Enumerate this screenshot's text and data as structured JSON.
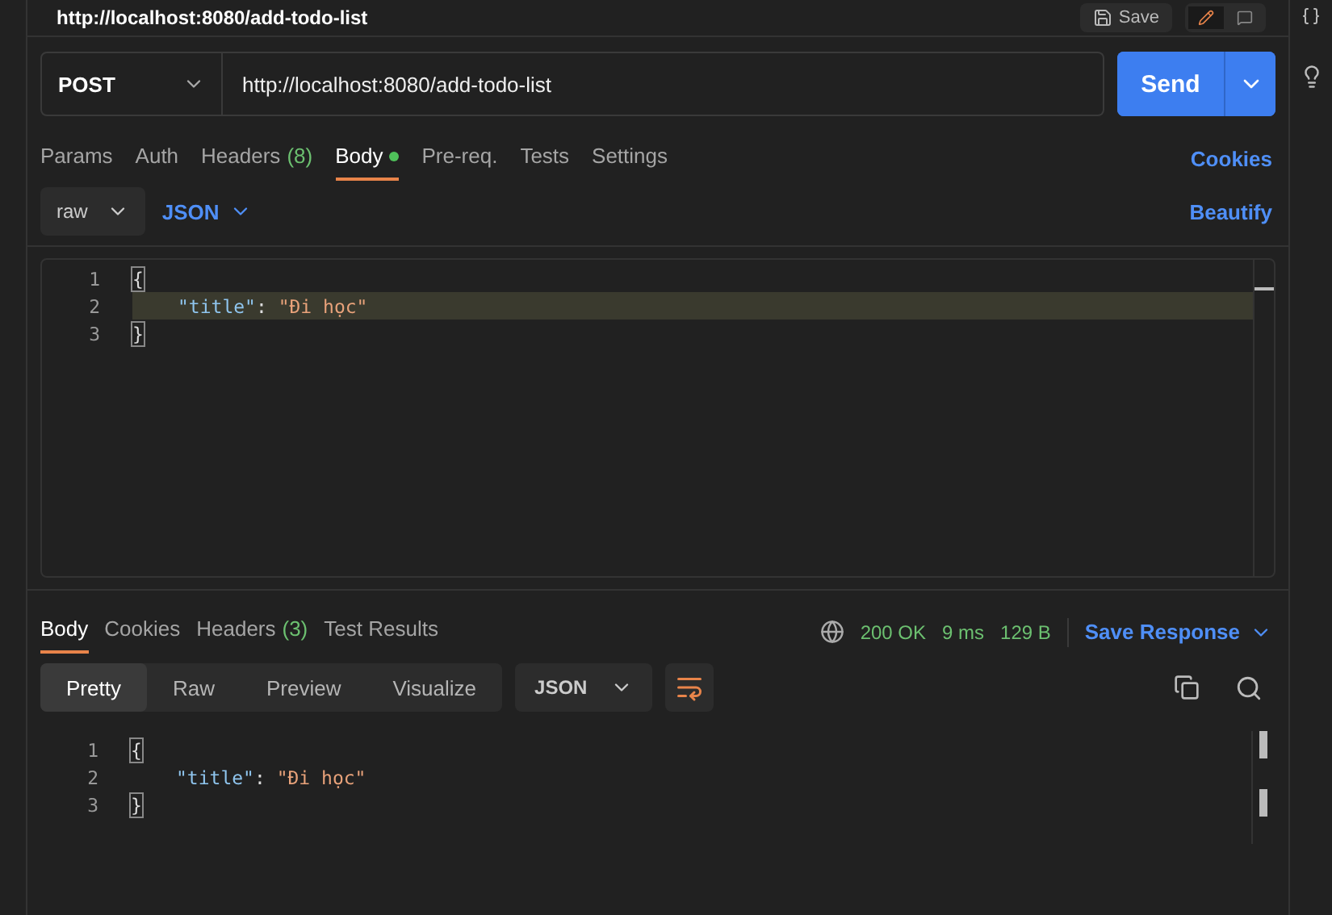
{
  "header": {
    "title": "http://localhost:8080/add-todo-list",
    "save_label": "Save"
  },
  "request": {
    "method": "POST",
    "url": "http://localhost:8080/add-todo-list",
    "send_label": "Send",
    "tabs": [
      {
        "label": "Params",
        "selected": false
      },
      {
        "label": "Auth",
        "selected": false
      },
      {
        "label": "Headers",
        "count": "(8)",
        "selected": false
      },
      {
        "label": "Body",
        "selected": true,
        "dot": true
      },
      {
        "label": "Pre-req.",
        "selected": false
      },
      {
        "label": "Tests",
        "selected": false
      },
      {
        "label": "Settings",
        "selected": false
      }
    ],
    "cookies_link": "Cookies",
    "body_mode": "raw",
    "body_language": "JSON",
    "beautify_link": "Beautify",
    "lines": [
      {
        "number": "1",
        "highlighted": false,
        "tokens": [
          {
            "kind": "bracket",
            "text": "{"
          }
        ]
      },
      {
        "number": "2",
        "highlighted": true,
        "tokens": [
          {
            "kind": "key",
            "text": "\"title\""
          },
          {
            "kind": "punct",
            "text": ": "
          },
          {
            "kind": "string",
            "text": "\"Đi học\""
          }
        ]
      },
      {
        "number": "3",
        "highlighted": false,
        "tokens": [
          {
            "kind": "bracket",
            "text": "}"
          }
        ]
      }
    ]
  },
  "response": {
    "tabs": [
      {
        "label": "Body",
        "selected": true
      },
      {
        "label": "Cookies",
        "selected": false
      },
      {
        "label": "Headers",
        "count": "(3)",
        "selected": false
      },
      {
        "label": "Test Results",
        "selected": false
      }
    ],
    "status": "200 OK",
    "time": "9 ms",
    "size": "129 B",
    "save_response": "Save Response",
    "views": [
      {
        "label": "Pretty",
        "selected": true
      },
      {
        "label": "Raw",
        "selected": false
      },
      {
        "label": "Preview",
        "selected": false
      },
      {
        "label": "Visualize",
        "selected": false
      }
    ],
    "format": "JSON",
    "lines": [
      {
        "number": "1",
        "tokens": [
          {
            "kind": "bracket",
            "text": "{"
          }
        ]
      },
      {
        "number": "2",
        "tokens": [
          {
            "kind": "key",
            "text": "\"title\""
          },
          {
            "kind": "punct",
            "text": ": "
          },
          {
            "kind": "string",
            "text": "\"Đi học\""
          }
        ]
      },
      {
        "number": "3",
        "tokens": [
          {
            "kind": "bracket",
            "text": "}"
          }
        ]
      }
    ]
  }
}
